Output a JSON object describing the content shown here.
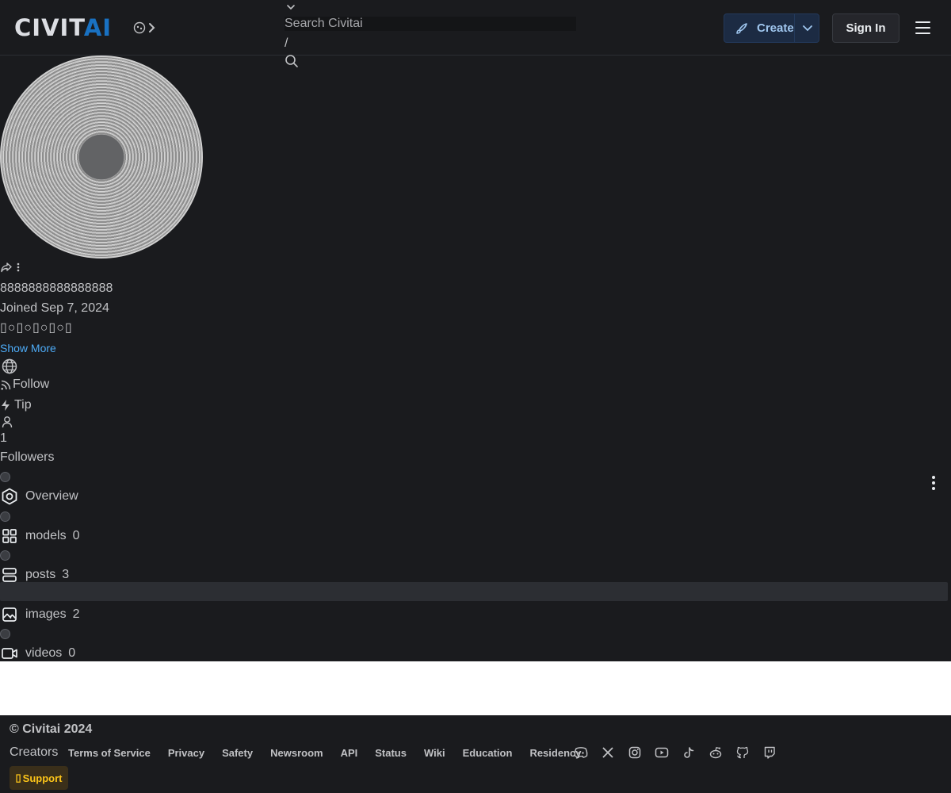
{
  "header": {
    "logo_left": "CIVIT",
    "logo_right": "AI",
    "search_placeholder": "Search Civitai",
    "search_shortcut": "/",
    "create_label": "Create",
    "signin_label": "Sign In"
  },
  "profile": {
    "username": "8888888888888888",
    "joined": "Joined Sep 7, 2024",
    "bio": "▯○▯○▯○▯○▯",
    "show_more": "Show More",
    "follow_label": "Follow",
    "tip_label": "Tip",
    "followers_count": "1",
    "followers_label": "Followers"
  },
  "tabs": [
    {
      "label": "Overview",
      "count": "",
      "icon": "overview-hexagon-icon"
    },
    {
      "label": "models",
      "count": "0",
      "icon": "models-grid-icon"
    },
    {
      "label": "posts",
      "count": "3",
      "icon": "posts-layout-icon"
    },
    {
      "label": "images",
      "count": "2",
      "icon": "images-photo-icon"
    },
    {
      "label": "videos",
      "count": "0",
      "icon": "videos-camera-icon"
    }
  ],
  "footer": {
    "copyright": "© Civitai 2024",
    "creators": "Creators",
    "links": [
      "Terms of Service",
      "Privacy",
      "Safety",
      "Newsroom",
      "API",
      "Status",
      "Wiki",
      "Education",
      "Residency"
    ],
    "support_label": "Support",
    "socials": [
      "discord-icon",
      "x-icon",
      "instagram-icon",
      "youtube-icon",
      "tiktok-icon",
      "reddit-icon",
      "github-icon",
      "twitch-icon"
    ]
  },
  "colors": {
    "background": "#1a1b1e",
    "accent_blue": "#1971c2",
    "link_blue": "#4dabf7",
    "support_yellow": "#fcc419"
  }
}
